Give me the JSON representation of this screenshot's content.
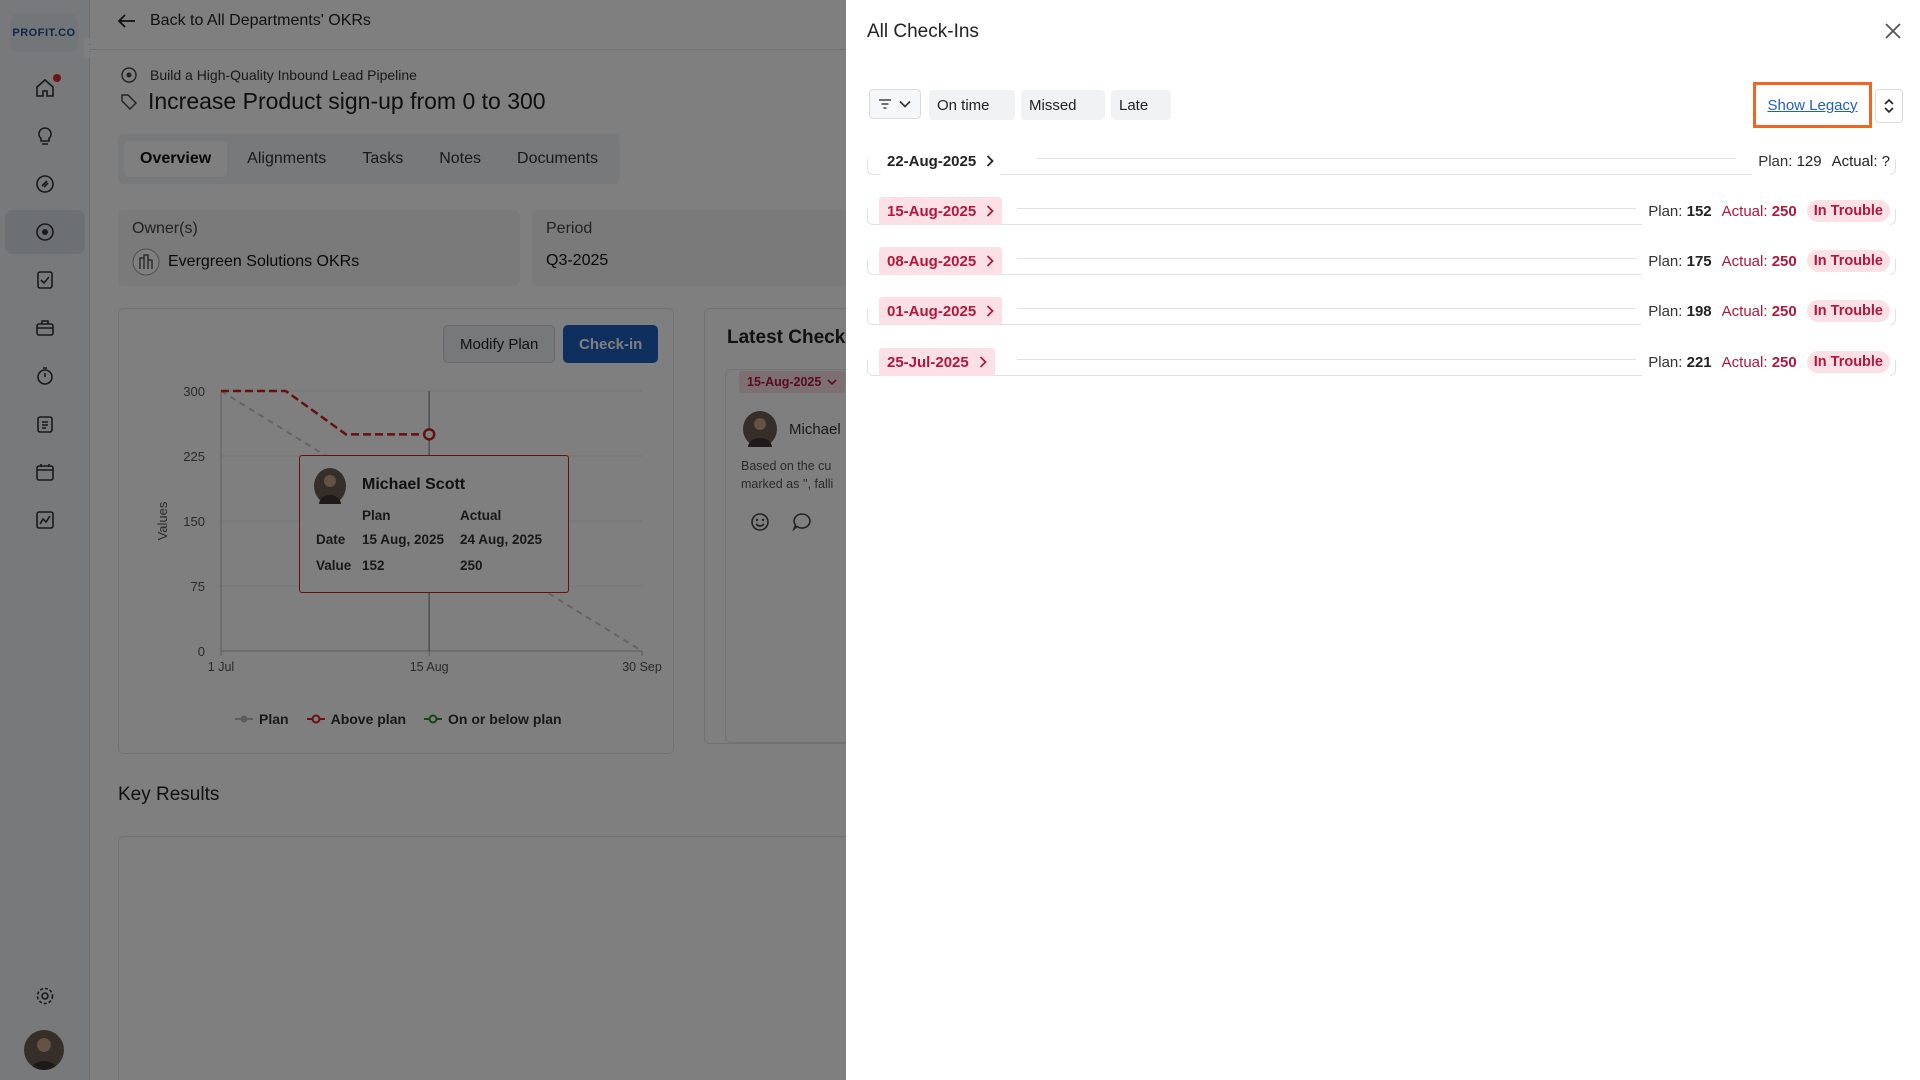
{
  "rail": {
    "logo_text": "PROFIT.CO",
    "items": [
      {
        "icon": "home-icon",
        "active": false
      },
      {
        "icon": "lightbulb-icon",
        "active": false
      },
      {
        "icon": "rocket-icon",
        "active": false
      },
      {
        "icon": "target-icon",
        "active": true
      },
      {
        "icon": "task-checklist-icon",
        "active": false
      },
      {
        "icon": "briefcase-icon",
        "active": false
      },
      {
        "icon": "stopwatch-icon",
        "active": false
      },
      {
        "icon": "clipboard-icon",
        "active": false
      },
      {
        "icon": "calendar-icon",
        "active": false
      },
      {
        "icon": "analytics-icon",
        "active": false
      }
    ],
    "settings_icon": "gear-icon"
  },
  "header": {
    "back_label": "Back to All Departments' OKRs",
    "objective": "Build a High-Quality Inbound Lead Pipeline",
    "key_result_title": "Increase Product sign-up from 0 to 300"
  },
  "tabs": [
    "Overview",
    "Alignments",
    "Tasks",
    "Notes",
    "Documents"
  ],
  "owner": {
    "label": "Owner(s)",
    "value": "Evergreen Solutions OKRs"
  },
  "period": {
    "label": "Period",
    "value": "Q3-2025"
  },
  "chart_buttons": {
    "modify": "Modify Plan",
    "checkin": "Check-in"
  },
  "chart_data": {
    "type": "line",
    "ylabel": "Values",
    "ylim": [
      0,
      300
    ],
    "yticks": [
      "300",
      "225",
      "150",
      "75",
      "0"
    ],
    "xticks": [
      "1 Jul",
      "15 Aug",
      "30 Sep"
    ],
    "series": [
      {
        "name": "Plan",
        "points": [
          {
            "x": "1 Jul",
            "y": 300
          },
          {
            "x": "30 Sep",
            "y": 0
          }
        ]
      },
      {
        "name": "Above plan",
        "points": [
          {
            "x": "1 Jul",
            "y": 300
          },
          {
            "x": "15 Jul",
            "y": 300
          },
          {
            "x": "28 Jul",
            "y": 250
          },
          {
            "x": "15 Aug",
            "y": 250
          }
        ]
      }
    ],
    "legend": [
      "Plan",
      "Above plan",
      "On or below plan"
    ]
  },
  "tooltip": {
    "name": "Michael Scott",
    "col_plan": "Plan",
    "col_actual": "Actual",
    "row_date": "Date",
    "row_value": "Value",
    "plan_date": "15 Aug, 2025",
    "actual_date": "24 Aug, 2025",
    "plan_value": "152",
    "actual_value": "250"
  },
  "latest_checkin": {
    "title": "Latest Check-",
    "date": "15-Aug-2025",
    "user": "Michael",
    "text_line1": "Based on the cu",
    "text_line2": "marked as '', falli"
  },
  "key_results_heading": "Key Results",
  "drawer": {
    "title": "All Check-Ins",
    "filters": [
      "On time",
      "Missed",
      "Late"
    ],
    "show_legacy": "Show Legacy",
    "rows": [
      {
        "date": "22-Aug-2025",
        "plan_label": "Plan:",
        "plan": "129",
        "actual_label": "Actual:",
        "actual": "?",
        "status": "",
        "style": "plain"
      },
      {
        "date": "15-Aug-2025",
        "plan_label": "Plan:",
        "plan": "152",
        "actual_label": "Actual:",
        "actual": "250",
        "status": "In Trouble",
        "style": "trouble"
      },
      {
        "date": "08-Aug-2025",
        "plan_label": "Plan:",
        "plan": "175",
        "actual_label": "Actual:",
        "actual": "250",
        "status": "In Trouble",
        "style": "trouble"
      },
      {
        "date": "01-Aug-2025",
        "plan_label": "Plan:",
        "plan": "198",
        "actual_label": "Actual:",
        "actual": "250",
        "status": "In Trouble",
        "style": "trouble"
      },
      {
        "date": "25-Jul-2025",
        "plan_label": "Plan:",
        "plan": "221",
        "actual_label": "Actual:",
        "actual": "250",
        "status": "In Trouble",
        "style": "trouble"
      }
    ]
  }
}
